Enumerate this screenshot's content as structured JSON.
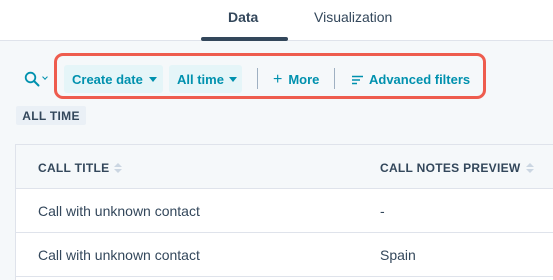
{
  "tabs": [
    {
      "label": "Data",
      "active": true
    },
    {
      "label": "Visualization",
      "active": false
    }
  ],
  "filters": {
    "search_icon": "search-icon",
    "date_property": {
      "label": "Create date"
    },
    "date_range": {
      "label": "All time"
    },
    "more": {
      "icon": "plus-icon",
      "label": "More"
    },
    "advanced": {
      "icon": "filter-lines-icon",
      "label": "Advanced filters"
    },
    "highlight_color": "#ee5c4e"
  },
  "active_filter_badge": "ALL TIME",
  "table": {
    "columns": [
      "CALL TITLE",
      "CALL NOTES PREVIEW"
    ],
    "rows": [
      [
        "Call with unknown contact",
        "-"
      ],
      [
        "Call with unknown contact",
        "Spain"
      ]
    ]
  },
  "colors": {
    "accent": "#0091ae",
    "chip_bg": "#e5f5f8",
    "text": "#33475b"
  }
}
